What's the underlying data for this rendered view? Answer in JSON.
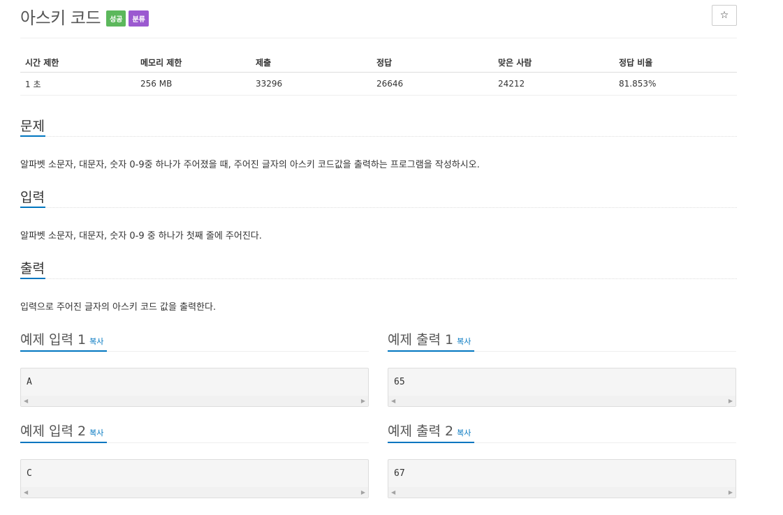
{
  "problem": {
    "title": "아스키 코드",
    "badges": {
      "success": "성공",
      "category": "분류"
    },
    "star_icon": "☆"
  },
  "info": {
    "headers": [
      "시간 제한",
      "메모리 제한",
      "제출",
      "정답",
      "맞은 사람",
      "정답 비율"
    ],
    "values": [
      "1 초",
      "256 MB",
      "33296",
      "26646",
      "24212",
      "81.853%"
    ]
  },
  "sections": {
    "description": {
      "title": "문제",
      "text": "알파벳 소문자, 대문자, 숫자 0-9중 하나가 주어졌을 때, 주어진 글자의 아스키 코드값을 출력하는 프로그램을 작성하시오."
    },
    "input": {
      "title": "입력",
      "text": "알파벳 소문자, 대문자, 숫자 0-9 중 하나가 첫째 줄에 주어진다."
    },
    "output": {
      "title": "출력",
      "text": "입력으로 주어진 글자의 아스키 코드 값을 출력한다."
    }
  },
  "samples": {
    "copy_label": "복사",
    "input1": {
      "title": "예제 입력 1",
      "value": "A"
    },
    "output1": {
      "title": "예제 출력 1",
      "value": "65"
    },
    "input2": {
      "title": "예제 입력 2",
      "value": "C"
    },
    "output2": {
      "title": "예제 출력 2",
      "value": "67"
    }
  }
}
